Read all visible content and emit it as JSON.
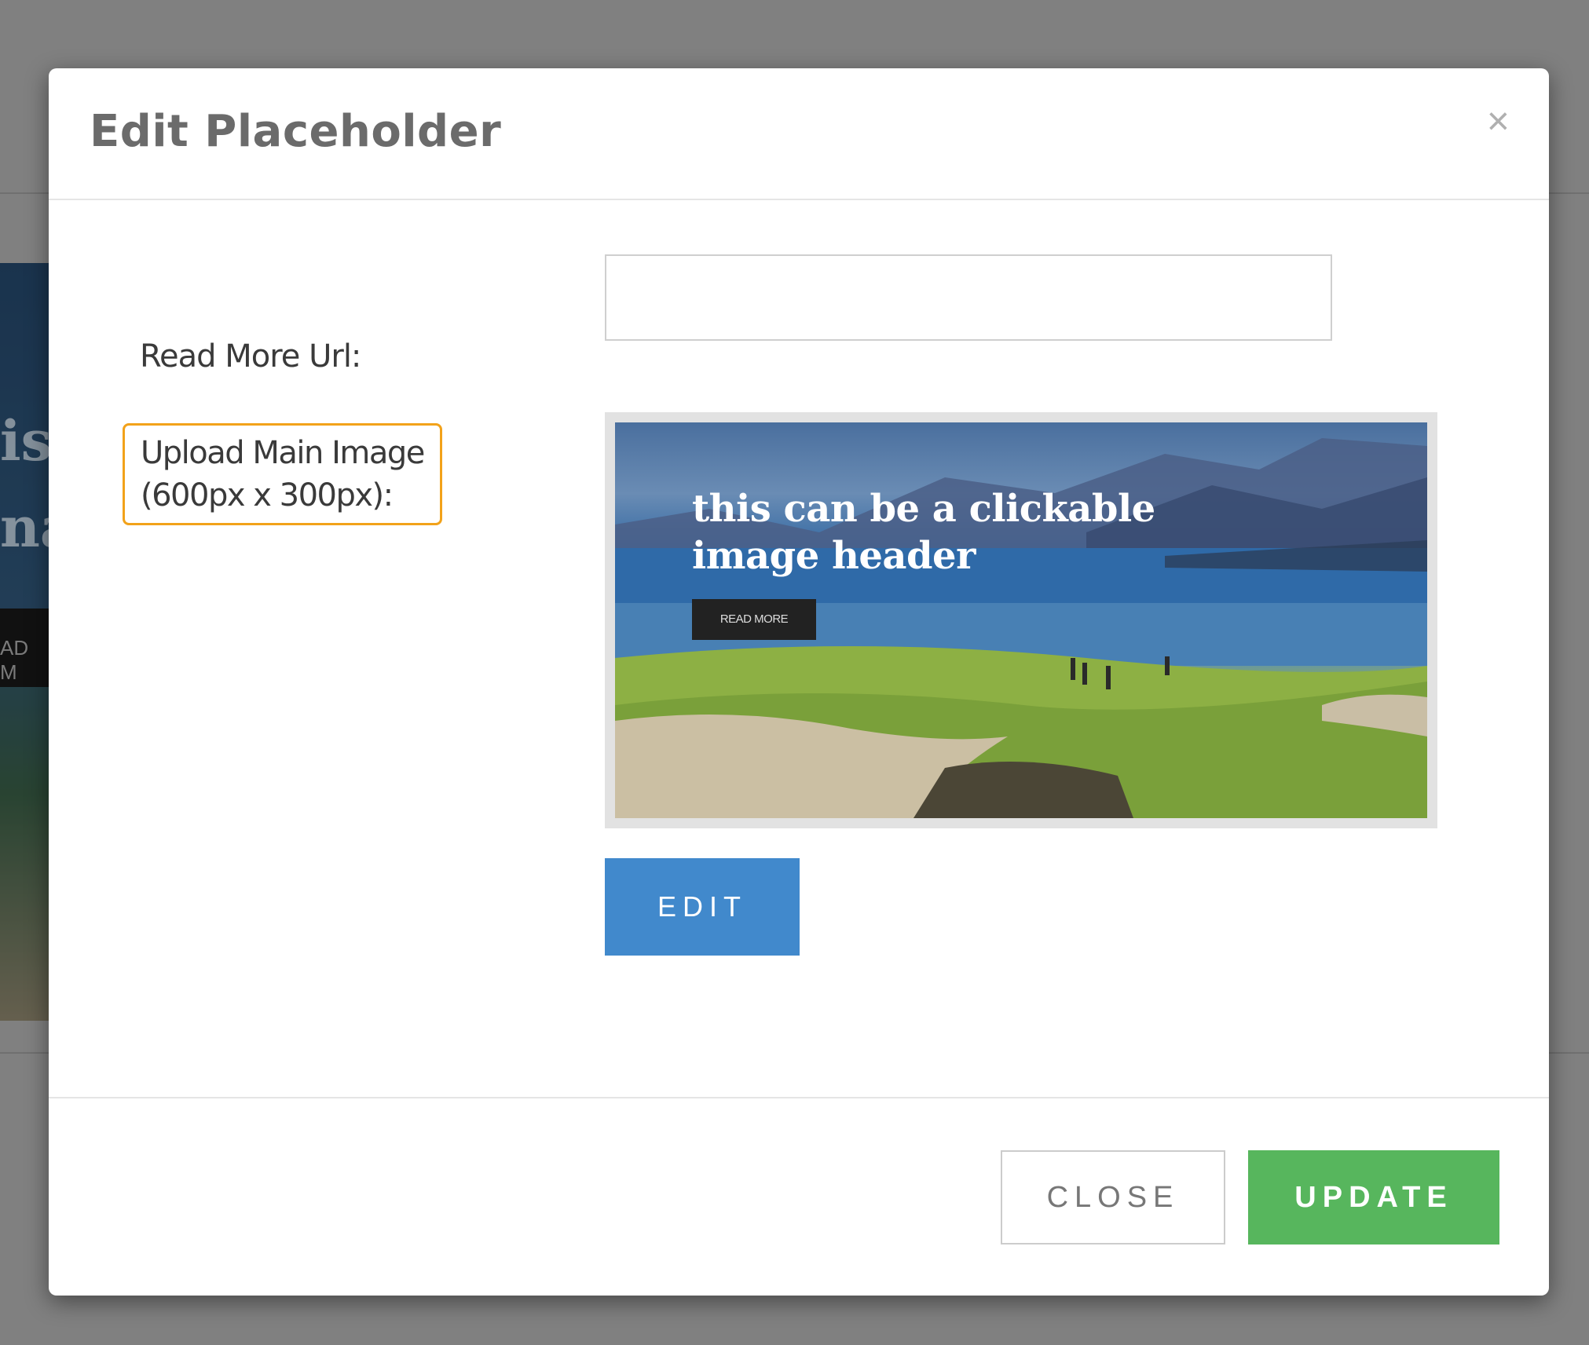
{
  "background": {
    "partial_text_1": "is",
    "partial_text_2": "na",
    "partial_button": "AD M"
  },
  "modal": {
    "title": "Edit Placeholder",
    "close_icon": "×",
    "read_more_label": "Read More Url:",
    "read_more_value": "",
    "upload_label_line1": "Upload Main Image",
    "upload_label_line2": "(600px x 300px):",
    "image_preview": {
      "headline": "this can be a clickable image header",
      "button_label": "READ MORE"
    },
    "edit_button": "EDIT",
    "close_button": "CLOSE",
    "update_button": "UPDATE"
  },
  "colors": {
    "edit_button": "#4189cc",
    "update_button": "#57b65d",
    "upload_label_highlight": "#f2a21a"
  }
}
